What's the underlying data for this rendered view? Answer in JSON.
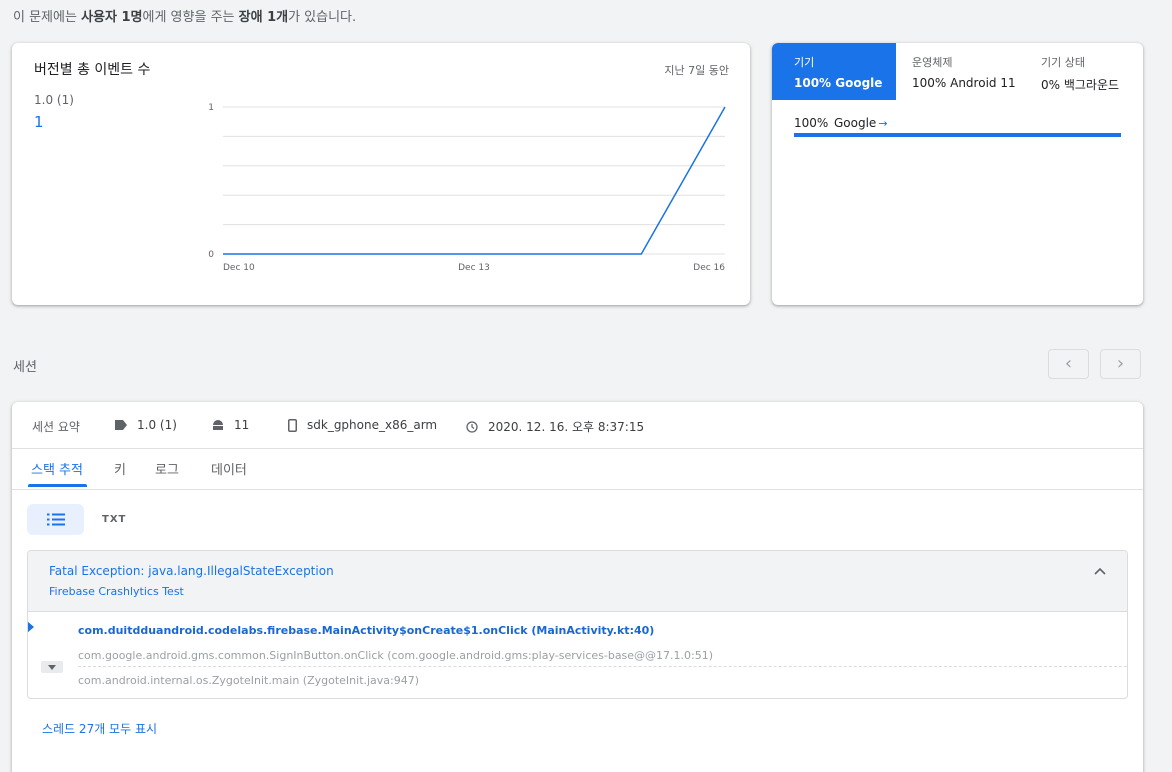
{
  "summary": {
    "pre": "이 문제에는 ",
    "users": "사용자 1명",
    "mid": "에게 영향을 주는 ",
    "crashes": "장애 1개",
    "post": "가 있습니다."
  },
  "version_chart": {
    "title": "버전별 총 이벤트 수",
    "range": "지난 7일 동안",
    "legend_name": "1.0 (1)",
    "legend_value": "1"
  },
  "chart_data": {
    "type": "line",
    "x": [
      "Dec 10",
      "Dec 11",
      "Dec 12",
      "Dec 13",
      "Dec 14",
      "Dec 15",
      "Dec 16"
    ],
    "series": [
      {
        "values": [
          0,
          0,
          0,
          0,
          0,
          0,
          1
        ]
      }
    ],
    "x_ticks": [
      "Dec 10",
      "Dec 13",
      "Dec 16"
    ],
    "y_ticks": [
      0,
      1
    ],
    "ylim": [
      0,
      1
    ],
    "grid": true,
    "color": "#1a73e8"
  },
  "device": {
    "tabs": [
      {
        "label": "기기",
        "value": "100% Google"
      },
      {
        "label": "운영체제",
        "value": "100% Android 11"
      },
      {
        "label": "기기 상태",
        "value": "0% 백그라운드"
      }
    ],
    "row": {
      "pct": "100%",
      "name": "Google",
      "arrow": "→",
      "share": 1.0
    }
  },
  "sessions": {
    "title": "세션",
    "prev": "‹",
    "next": "›",
    "meta": {
      "label": "세션 요약",
      "version": "1.0 (1)",
      "os": "11",
      "device": "sdk_gphone_x86_arm",
      "time": "2020. 12. 16. 오후 8:37:15"
    },
    "tabs": [
      "스택 추적",
      "키",
      "로그",
      "데이터"
    ],
    "view_txt": "TXT",
    "exception": {
      "title": "Fatal Exception: java.lang.IllegalStateException",
      "subtitle": "Firebase Crashlytics Test",
      "frames": [
        "com.duitdduandroid.codelabs.firebase.MainActivity$onCreate$1.onClick (MainActivity.kt:40)",
        "com.google.android.gms.common.SignInButton.onClick (com.google.android.gms:play-services-base@@17.1.0:51)",
        "com.android.internal.os.ZygoteInit.main (ZygoteInit.java:947)"
      ]
    },
    "threads_link": "스레드 27개 모두 표시"
  },
  "colors": {
    "accent": "#1a73e8",
    "background": "#f1f3f4"
  },
  "icons": [
    "tag-icon",
    "android-icon",
    "phone-icon",
    "clock-icon",
    "list-icon",
    "chevron-up-icon",
    "chevron-down-icon"
  ]
}
